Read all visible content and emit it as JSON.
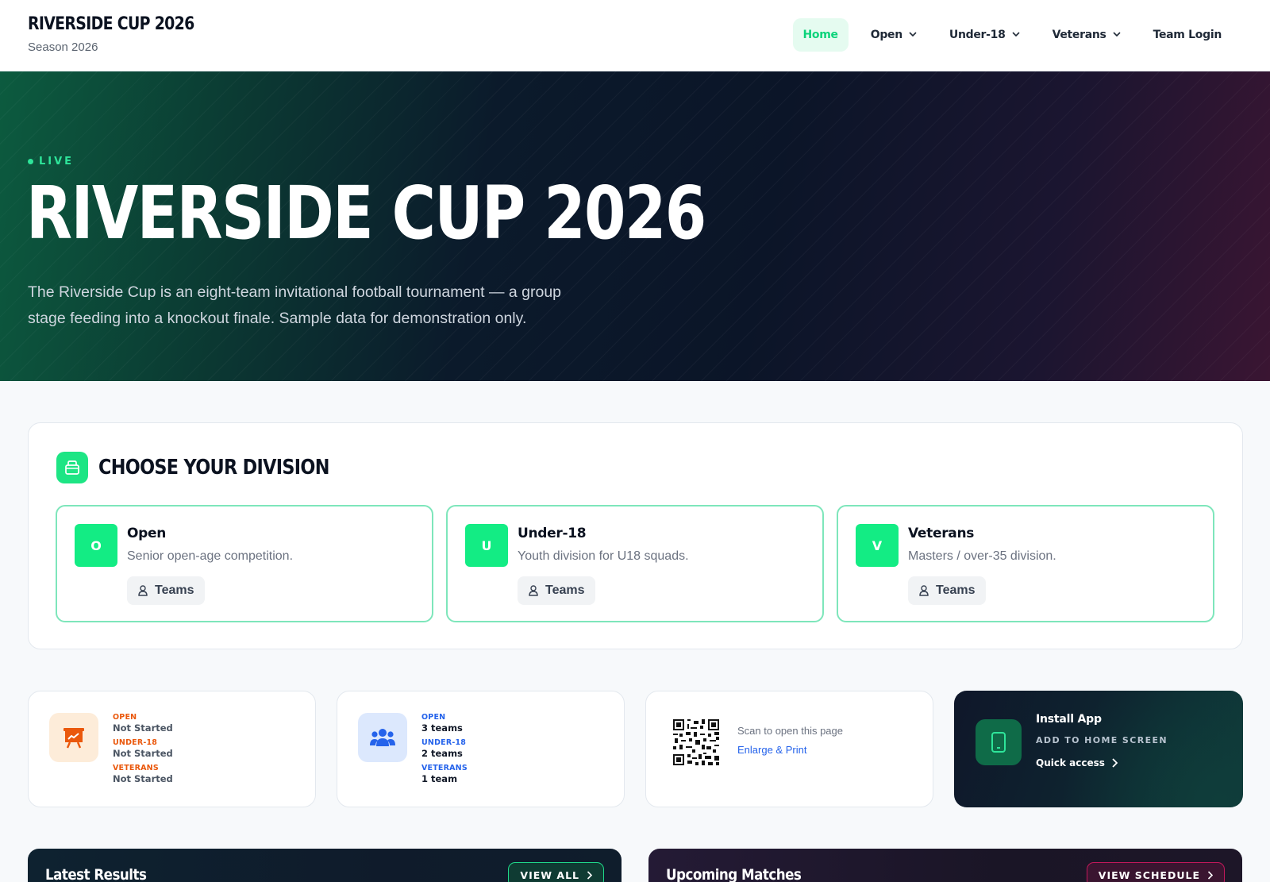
{
  "brand": {
    "title": "RIVERSIDE CUP 2026",
    "subtitle": "Season 2026"
  },
  "nav": {
    "items": [
      {
        "label": "Home",
        "active": true,
        "dropdown": false
      },
      {
        "label": "Open",
        "active": false,
        "dropdown": true
      },
      {
        "label": "Under-18",
        "active": false,
        "dropdown": true
      },
      {
        "label": "Veterans",
        "active": false,
        "dropdown": true
      },
      {
        "label": "Team Login",
        "active": false,
        "dropdown": false
      }
    ]
  },
  "hero": {
    "live_label": "LIVE",
    "title": "RIVERSIDE CUP 2026",
    "description": "The Riverside Cup is an eight-team invitational football tournament — a group stage feeding into a knockout finale. Sample data for demonstration only."
  },
  "divisions": {
    "heading": "CHOOSE YOUR DIVISION",
    "icon": "division-icon",
    "cards": [
      {
        "badge": "O",
        "name": "Open",
        "description": "Senior open-age competition.",
        "teams_label": "Teams"
      },
      {
        "badge": "U",
        "name": "Under-18",
        "description": "Youth division for U18 squads.",
        "teams_label": "Teams"
      },
      {
        "badge": "V",
        "name": "Veterans",
        "description": "Masters / over-35 division.",
        "teams_label": "Teams"
      }
    ]
  },
  "status_card": {
    "icon": "presentation-chart-icon",
    "items": [
      {
        "label": "OPEN",
        "value": "Not Started"
      },
      {
        "label": "UNDER-18",
        "value": "Not Started"
      },
      {
        "label": "VETERANS",
        "value": "Not Started"
      }
    ]
  },
  "teams_card": {
    "icon": "users-group-icon",
    "items": [
      {
        "label": "OPEN",
        "value": "3 teams"
      },
      {
        "label": "UNDER-18",
        "value": "2 teams"
      },
      {
        "label": "VETERANS",
        "value": "1 team"
      }
    ]
  },
  "qr_card": {
    "hint": "Scan to open this page",
    "link": "Enlarge & Print"
  },
  "install_card": {
    "title": "Install App",
    "subtitle": "ADD TO HOME SCREEN",
    "link": "Quick access",
    "icon": "phone-icon"
  },
  "sections": {
    "results": {
      "title": "Latest Results",
      "button": "VIEW ALL"
    },
    "upcoming": {
      "title": "Upcoming Matches",
      "button": "VIEW SCHEDULE"
    }
  },
  "colors": {
    "accent": "#13ec84",
    "status_orange": "#ea580c",
    "teams_blue": "#2563eb",
    "dark": "#0f172a"
  }
}
